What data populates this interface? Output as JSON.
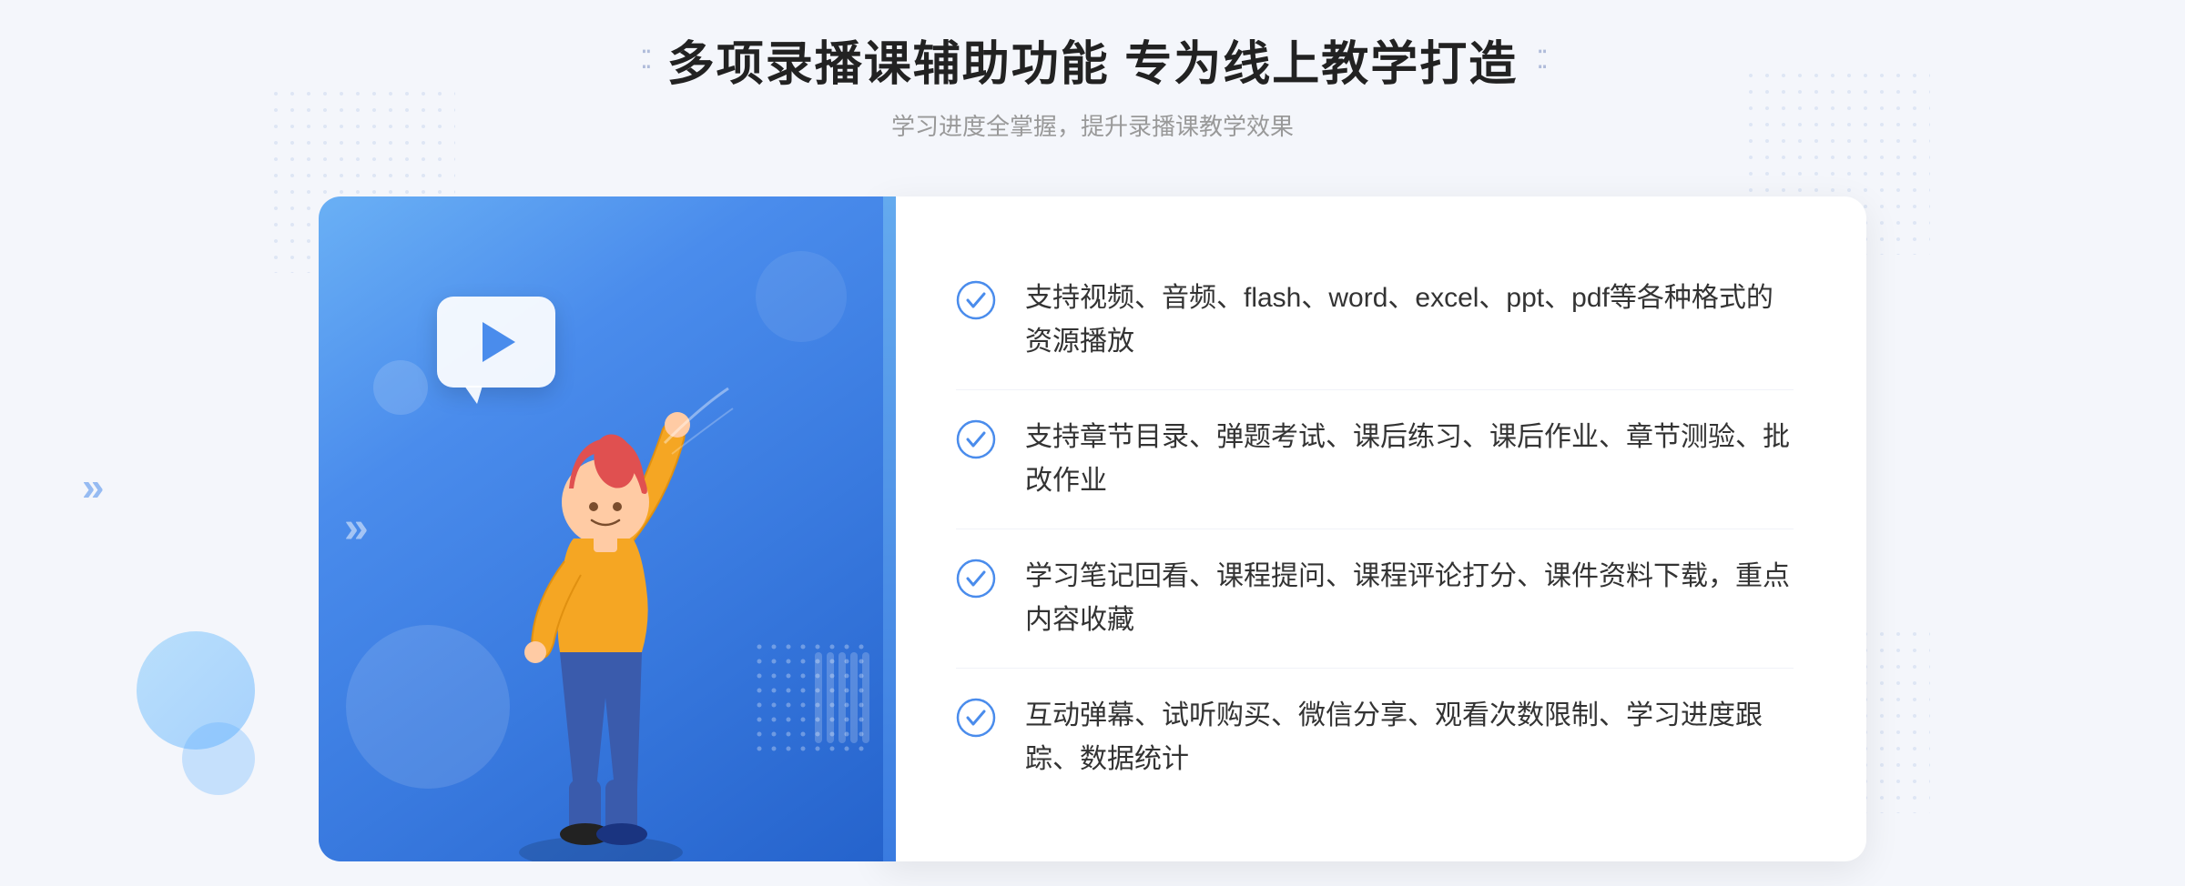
{
  "page": {
    "background_color": "#f4f6fb"
  },
  "header": {
    "deco_left": "⁚ ⁚",
    "deco_right": "⁚ ⁚",
    "main_title": "多项录播课辅助功能 专为线上教学打造",
    "sub_title": "学习进度全掌握，提升录播课教学效果"
  },
  "features": [
    {
      "id": 1,
      "text": "支持视频、音频、flash、word、excel、ppt、pdf等各种格式的资源播放"
    },
    {
      "id": 2,
      "text": "支持章节目录、弹题考试、课后练习、课后作业、章节测验、批改作业"
    },
    {
      "id": 3,
      "text": "学习笔记回看、课程提问、课程评论打分、课件资料下载，重点内容收藏"
    },
    {
      "id": 4,
      "text": "互动弹幕、试听购买、微信分享、观看次数限制、学习进度跟踪、数据统计"
    }
  ],
  "icons": {
    "check_color": "#4a8cec",
    "play_color": "#4a8cec"
  }
}
